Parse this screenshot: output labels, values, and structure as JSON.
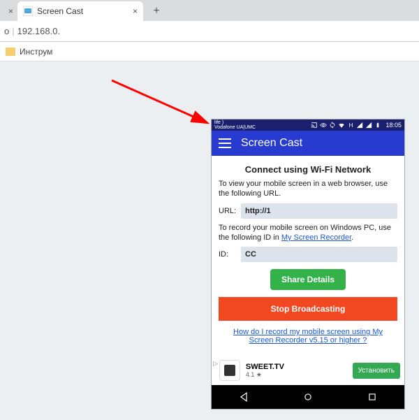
{
  "browser": {
    "tabs": [
      {
        "title": "",
        "favicon": "#e3e3e3"
      },
      {
        "title": "Screen Cast",
        "favicon": "#5db0e6"
      }
    ],
    "address_prefix": "o",
    "address": "192.168.0.",
    "bookmarks": [
      {
        "label": "Инструм"
      }
    ]
  },
  "phone": {
    "status": {
      "carrier_line1": "life )",
      "carrier_line2": "Vodafone UA|UMC",
      "time": "18:05"
    },
    "appbar": {
      "title": "Screen Cast"
    },
    "content": {
      "heading": "Connect using Wi-Fi Network",
      "view_text": "To view your mobile screen in a web browser, use the following URL.",
      "url_label": "URL:",
      "url_value": "http://1",
      "record_text_pre": "To record your mobile screen on Windows PC, use the following ID in ",
      "record_link": "My Screen Recorder",
      "record_text_post": ".",
      "id_label": "ID:",
      "id_value": "CC",
      "share_button": "Share Details",
      "stop_button": "Stop Broadcasting",
      "help_link": "How do I record my mobile screen using My Screen Recorder v5.15 or higher ?"
    },
    "ad": {
      "app_name": "SWEET.TV",
      "rating": "4.1 ★",
      "install": "Установить"
    }
  }
}
